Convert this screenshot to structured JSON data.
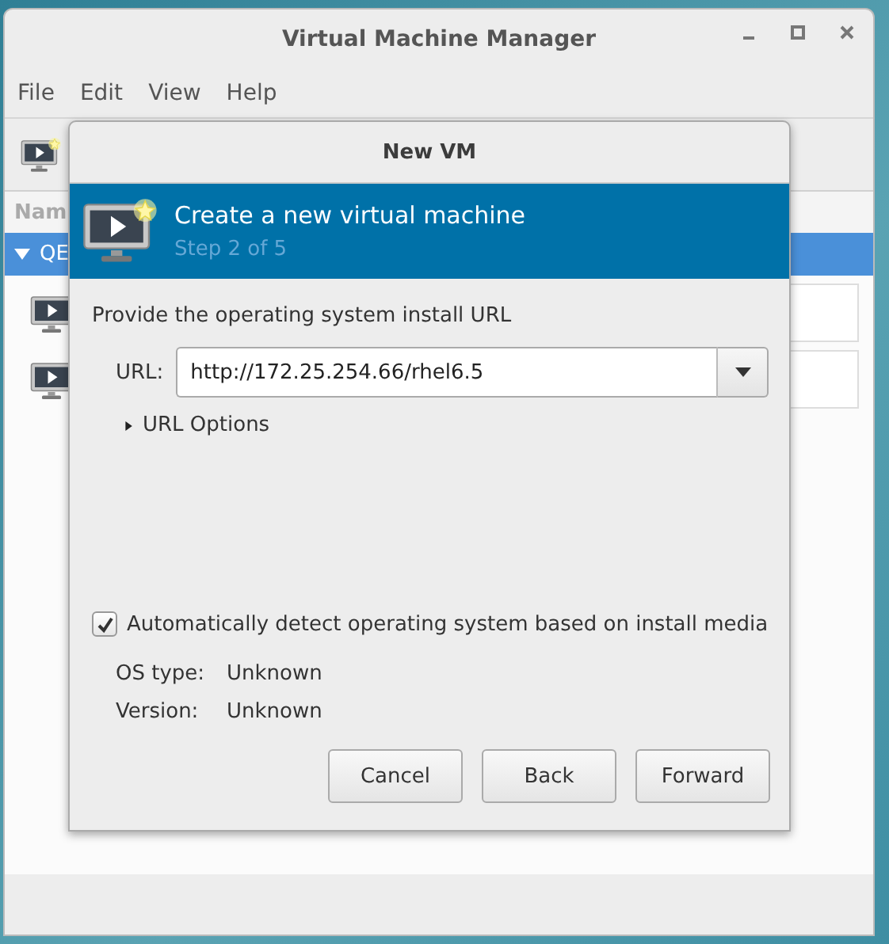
{
  "window": {
    "title": "Virtual Machine Manager"
  },
  "menu": [
    "File",
    "Edit",
    "View",
    "Help"
  ],
  "list": {
    "column_1": "Nam",
    "group": {
      "label": "QE",
      "expanded": true,
      "selected": true
    },
    "rows": [
      {
        "kind": "vm"
      },
      {
        "kind": "vm"
      }
    ]
  },
  "dialog": {
    "title": "New VM",
    "header": {
      "title": "Create a new virtual machine",
      "step": "Step 2 of 5"
    },
    "prompt": "Provide the operating system install URL",
    "url": {
      "label": "URL:",
      "value": "http://172.25.254.66/rhel6.5"
    },
    "url_options": {
      "label": "URL Options",
      "expanded": false
    },
    "auto_detect": {
      "label": "Automatically detect operating system based on install media",
      "checked": true
    },
    "os_info": [
      {
        "label": "OS type:",
        "value": "Unknown"
      },
      {
        "label": "Version:",
        "value": "Unknown"
      }
    ],
    "buttons": [
      "Cancel",
      "Back",
      "Forward"
    ]
  }
}
